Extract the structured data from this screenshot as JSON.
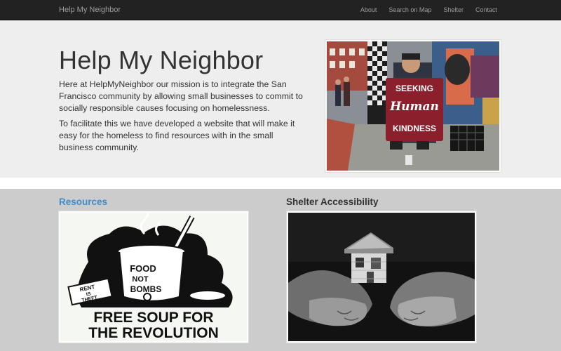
{
  "navbar": {
    "brand": "Help My Neighbor",
    "links": [
      "About",
      "Search on Map",
      "Shelter",
      "Contact"
    ]
  },
  "hero": {
    "title": "Help My Neighbor",
    "paragraph1": "Here at HelpMyNeighbor our mission is to integrate the San Francisco community by allowing small businesses to commit to socially responsible causes focusing on homelessness.",
    "paragraph2": "To facilitate this we have developed a website that will make it easy for the homeless to find resources with in the small business community.",
    "photo_sign": [
      "SEEKING",
      "Human",
      "KINDNESS"
    ]
  },
  "columns": {
    "resources_heading": "Resources",
    "shelter_heading": "Shelter Accessibility"
  },
  "resources_image": {
    "pot_text": [
      "FOOD",
      "NOT",
      "BOMBS"
    ],
    "book_text": [
      "RENT",
      "IS",
      "THEFT"
    ],
    "caption_line1": "FREE SOUP FOR",
    "caption_line2": "THE REVOLUTION"
  }
}
